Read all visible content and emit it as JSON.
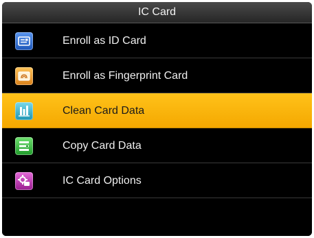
{
  "header": {
    "title": "IC Card"
  },
  "menu": {
    "items": [
      {
        "label": "Enroll as ID Card",
        "icon": "id-card-icon",
        "color": "#2f6fd6",
        "selected": false
      },
      {
        "label": "Enroll as Fingerprint Card",
        "icon": "fingerprint-card-icon",
        "color": "#f0a030",
        "selected": false
      },
      {
        "label": "Clean Card Data",
        "icon": "clean-data-icon",
        "color": "#35b5d0",
        "selected": true
      },
      {
        "label": "Copy Card Data",
        "icon": "copy-data-icon",
        "color": "#3fbf3f",
        "selected": false
      },
      {
        "label": "IC Card Options",
        "icon": "card-options-icon",
        "color": "#c23bb5",
        "selected": false
      }
    ]
  },
  "colors": {
    "highlight": "#f7b000",
    "background": "#000000",
    "text": "#f0f0f0"
  }
}
